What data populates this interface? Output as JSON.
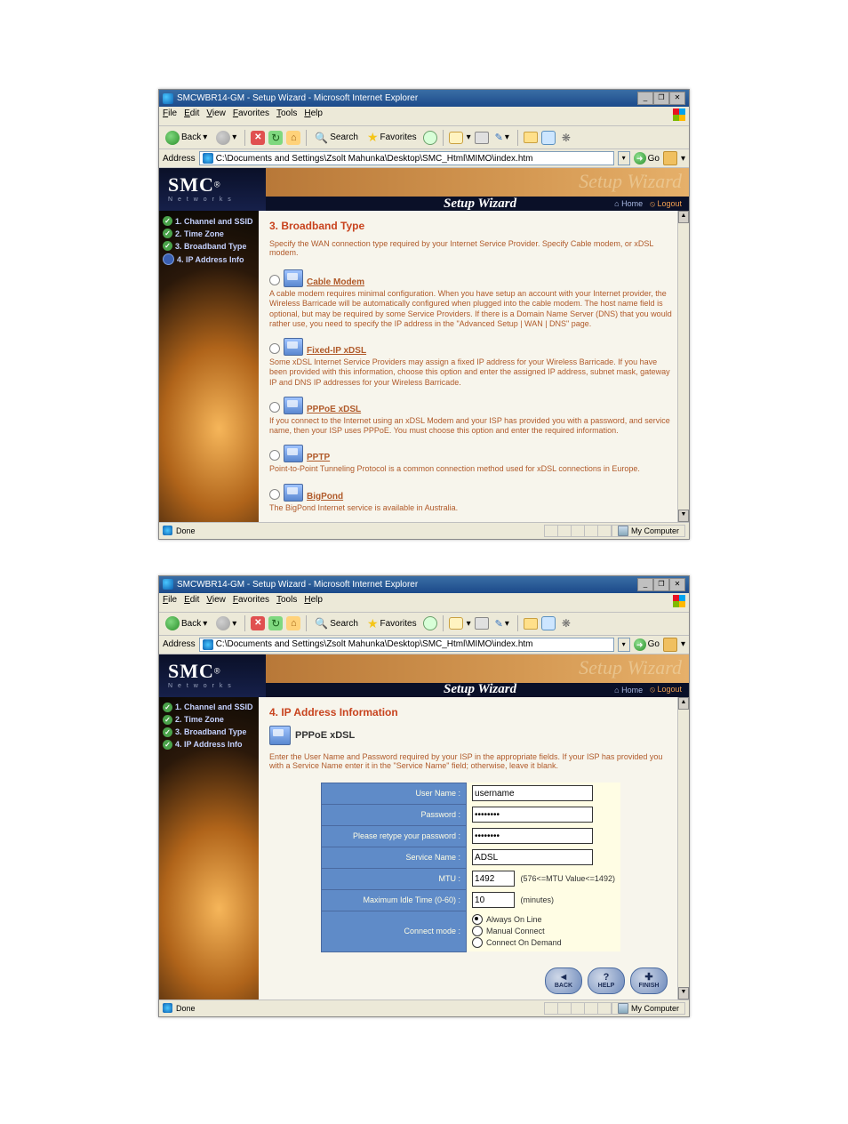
{
  "ie": {
    "title": "SMCWBR14-GM - Setup Wizard - Microsoft Internet Explorer",
    "menu": {
      "file": "File",
      "edit": "Edit",
      "view": "View",
      "favorites": "Favorites",
      "tools": "Tools",
      "help": "Help"
    },
    "toolbar": {
      "back": "Back",
      "search": "Search",
      "favorites": "Favorites"
    },
    "address_label": "Address",
    "address_path": "C:\\Documents and Settings\\Zsolt Mahunka\\Desktop\\SMC_Html\\MIMO\\index.htm",
    "go": "Go",
    "status_done": "Done",
    "status_zone": "My Computer"
  },
  "branding": {
    "logo": "SMC",
    "logo_reg": "®",
    "logo_sub": "N e t w o r k s",
    "banner_faint": "Setup Wizard",
    "banner_label": "Setup Wizard",
    "home": "Home",
    "logout": "Logout"
  },
  "steps": {
    "s1": "1. Channel and SSID",
    "s2": "2. Time Zone",
    "s3": "3. Broadband Type",
    "s4": "4. IP Address Info"
  },
  "page3": {
    "title": "3. Broadband Type",
    "intro": "Specify the WAN connection type required by your Internet Service Provider. Specify Cable modem, or xDSL modem.",
    "opt_cable_title": "Cable Modem",
    "opt_cable_desc": "A cable modem requires minimal configuration. When you have setup an account with your Internet provider, the Wireless Barricade will be automatically configured when plugged into the cable modem. The host name field is optional, but may be required by some Service Providers. If there is a Domain Name Server (DNS) that you would rather use, you need to specify the IP address in the \"Advanced Setup | WAN | DNS\" page.",
    "opt_fixed_title": "Fixed-IP xDSL",
    "opt_fixed_desc": "Some xDSL Internet Service Providers may assign a fixed IP address for your Wireless Barricade. If you have been provided with this information, choose this option and enter the assigned IP address, subnet mask, gateway IP and DNS IP addresses for your Wireless Barricade.",
    "opt_pppoe_title": "PPPoE xDSL",
    "opt_pppoe_desc": "If you connect to the Internet using an xDSL Modem and your ISP has provided you with a password, and service name, then your ISP uses PPPoE. You must choose this option and enter the required information.",
    "opt_pptp_title": "PPTP",
    "opt_pptp_desc": "Point-to-Point Tunneling Protocol is a common connection method used for xDSL connections in Europe.",
    "opt_bigpond_title": "BigPond",
    "opt_bigpond_desc": "The BigPond Internet service is available in Australia."
  },
  "page4": {
    "title": "4. IP Address Information",
    "subtype": "PPPoE xDSL",
    "intro": "Enter the User Name and Password required by your ISP in the appropriate fields. If your ISP has provided you with a Service Name enter it in the \"Service Name\" field; otherwise, leave it blank.",
    "labels": {
      "user": "User Name :",
      "pass": "Password :",
      "pass2": "Please retype your password :",
      "svc": "Service Name :",
      "mtu": "MTU :",
      "idle": "Maximum Idle Time (0-60) :",
      "mode": "Connect mode :"
    },
    "values": {
      "user": "username",
      "pass": "••••••••",
      "pass2": "••••••••",
      "svc": "ADSL",
      "mtu": "1492",
      "mtu_hint": "(576<=MTU Value<=1492)",
      "idle": "10",
      "idle_hint": "(minutes)",
      "mode_always": "Always On Line",
      "mode_manual": "Manual Connect",
      "mode_demand": "Connect On Demand"
    },
    "buttons": {
      "back": "BACK",
      "help": "HELP",
      "finish": "FINISH"
    }
  }
}
